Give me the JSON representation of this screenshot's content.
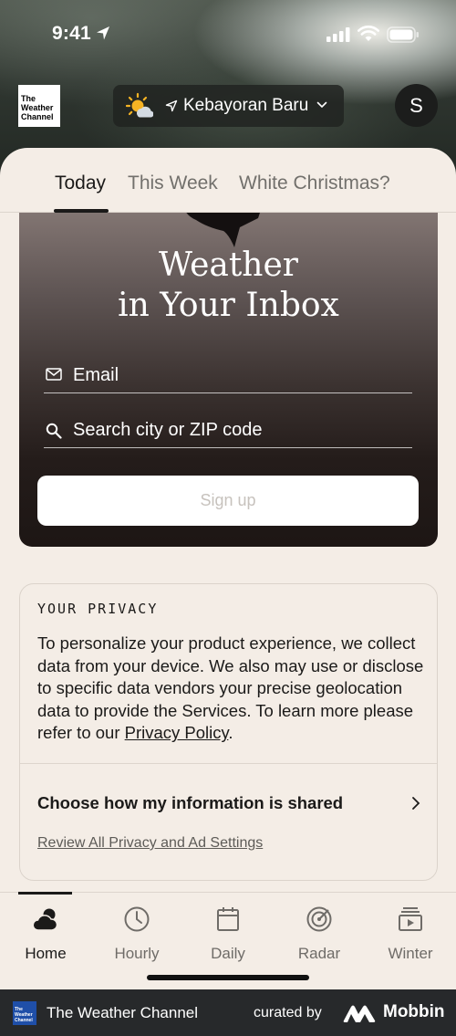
{
  "status_bar": {
    "time": "9:41"
  },
  "header": {
    "logo_lines": [
      "The",
      "Weather",
      "Channel"
    ],
    "location": "Kebayoran Baru",
    "avatar_initial": "S"
  },
  "tabs": [
    {
      "label": "Today",
      "active": true
    },
    {
      "label": "This Week",
      "active": false
    },
    {
      "label": "White Christmas?",
      "active": false
    }
  ],
  "inbox": {
    "title_line1": "Weather",
    "title_line2": "in Your Inbox",
    "email_placeholder": "Email",
    "search_placeholder": "Search city or ZIP code",
    "signup_label": "Sign up"
  },
  "privacy": {
    "heading": "YOUR PRIVACY",
    "body": "To personalize your product experience, we collect data from your device. We also may use or disclose to specific data vendors your precise geolocation data to provide the Services. To learn more please refer to our ",
    "policy_link": "Privacy Policy",
    "body_end": ".",
    "choose_label": "Choose how my information is shared",
    "review_link": "Review All Privacy and Ad Settings"
  },
  "bottom_nav": [
    {
      "label": "Home",
      "icon": "cloud-sun-icon",
      "active": true
    },
    {
      "label": "Hourly",
      "icon": "clock-icon",
      "active": false
    },
    {
      "label": "Daily",
      "icon": "calendar-icon",
      "active": false
    },
    {
      "label": "Radar",
      "icon": "radar-icon",
      "active": false
    },
    {
      "label": "Winter",
      "icon": "video-icon",
      "active": false
    }
  ],
  "footer": {
    "logo_lines": [
      "The",
      "Weather",
      "Channel"
    ],
    "app_name": "The Weather Channel",
    "curated_by": "curated by",
    "brand": "Mobbin"
  }
}
